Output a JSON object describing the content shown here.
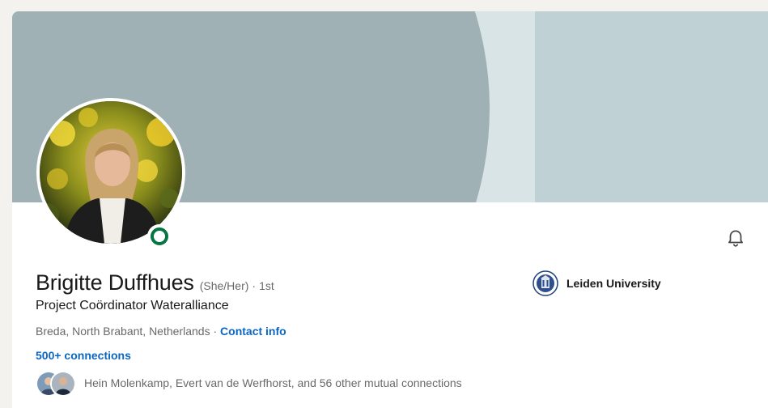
{
  "profile": {
    "name": "Brigitte Duffhues",
    "pronouns": "(She/Her)",
    "separator": "·",
    "degree": "1st",
    "headline": "Project Coördinator Wateralliance",
    "location": "Breda, North Brabant, Netherlands",
    "location_separator": " · ",
    "contact_info_label": "Contact info",
    "connections": "500+ connections",
    "mutual_connections": "Hein Molenkamp, Evert van de Werfhorst, and 56 other mutual connections",
    "open_to_work_status": "online"
  },
  "education": {
    "school": "Leiden University",
    "logo_icon": "leiden-university-seal-icon"
  },
  "actions": {
    "notification_icon": "bell-icon"
  },
  "colors": {
    "link_blue": "#0a66c2",
    "status_green": "#057642",
    "cover_dark": "#9fb1b5",
    "cover_light": "#bfd1d4"
  }
}
